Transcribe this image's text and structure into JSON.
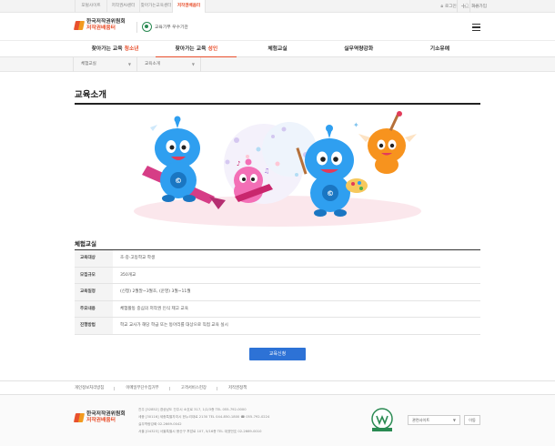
{
  "topbar": {
    "site_tabs": [
      {
        "label": "포털사이트",
        "active": false
      },
      {
        "label": "저작권AI센터",
        "active": false
      },
      {
        "label": "찾아가는교육센터",
        "active": false
      },
      {
        "label": "저작권배움터",
        "active": true
      }
    ],
    "login_label": "로그인",
    "join_label": "회원가입",
    "plus_label": "+",
    "line_label": "—"
  },
  "header": {
    "logo_line1": "한국저작권위원회",
    "logo_line2": "저작권배움터",
    "badge_text": "교육기부 우수기관"
  },
  "gnb": [
    {
      "pre": "찾아가는 교육 ",
      "hl": "청소년",
      "active": false
    },
    {
      "pre": "찾아가는 교육 ",
      "hl": "성인",
      "active": true
    },
    {
      "pre": "체험교실",
      "hl": "",
      "active": false
    },
    {
      "pre": "실무역량강화",
      "hl": "",
      "active": false
    },
    {
      "pre": "기소유예",
      "hl": "",
      "active": false
    }
  ],
  "breadcrumb": [
    "체험교실",
    "교육소개"
  ],
  "page_title": "교육소개",
  "section_title": "체험교실",
  "info_rows": [
    {
      "th": "교육대상",
      "td": "초·중·고등학교 학생"
    },
    {
      "th": "모집규모",
      "td": "350개교"
    },
    {
      "th": "교육일정",
      "td": "(신청) 2월말~3월초, (운영) 3월~11월"
    },
    {
      "th": "주요내용",
      "td": "체험활동 중심의 저작권 인식 제고 교육"
    },
    {
      "th": "진행방법",
      "td": "학교 교사가 해당 학급 또는 동아리를 대상으로 직접 교육 실시"
    }
  ],
  "apply_button": "교육신청",
  "footer": {
    "links": [
      "개인정보처리방침",
      "이메일무단수집거부",
      "고객서비스헌장",
      "저작권정책"
    ],
    "info_lines": [
      "진주 [52852] 경상남도 진주시 소호로 317, 1/2/3층  TEL 055-792-0000",
      "세종 [30116] 세종특별자치시 한누리대로 2130  TEL 044-850-1800  ☎ 055-792-0224",
      "실무역량강화 02-2669-0042",
      "서울 [04323] 서울특별시 용산구 후암로 107, 5/16층  TEL 대표번호 02-2669-0010"
    ],
    "select_label": "관련사이트",
    "go_label": "이동"
  },
  "colors": {
    "accent": "#e8502d",
    "button": "#2d72d6",
    "brand_green": "#2a8a52"
  }
}
